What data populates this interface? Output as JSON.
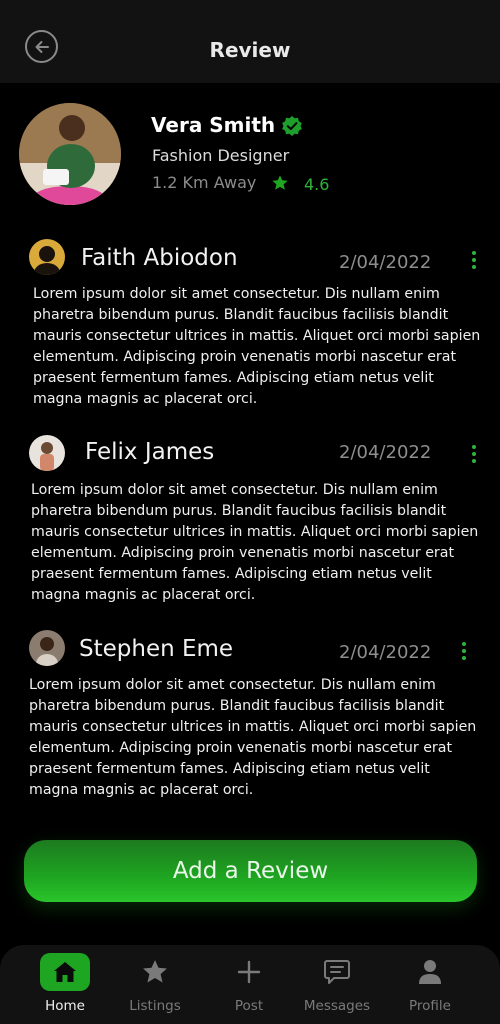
{
  "header": {
    "title": "Review"
  },
  "profile": {
    "name": "Vera Smith",
    "role": "Fashion Designer",
    "distance": "1.2 Km Away",
    "rating": "4.6"
  },
  "reviews": [
    {
      "name": "Faith Abiodon",
      "date": "2/04/2022",
      "text": "Lorem ipsum dolor sit amet consectetur. Dis nullam enim pharetra bibendum purus. Blandit faucibus facilisis blandit mauris consectetur ultrices in mattis. Aliquet orci morbi sapien elementum. Adipiscing proin venenatis morbi nascetur erat praesent fermentum fames. Adipiscing etiam netus velit magna magnis ac placerat orci."
    },
    {
      "name": "Felix James",
      "date": "2/04/2022",
      "text": "Lorem ipsum dolor sit amet consectetur. Dis nullam enim pharetra bibendum purus. Blandit faucibus facilisis blandit mauris consectetur ultrices in mattis. Aliquet orci morbi sapien elementum. Adipiscing proin venenatis morbi nascetur erat praesent fermentum fames. Adipiscing etiam netus velit magna magnis ac placerat orci."
    },
    {
      "name": "Stephen Eme",
      "date": "2/04/2022",
      "text": "Lorem ipsum dolor sit amet consectetur. Dis nullam enim pharetra bibendum purus. Blandit faucibus facilisis blandit mauris consectetur ultrices in mattis. Aliquet orci morbi sapien elementum. Adipiscing proin venenatis morbi nascetur erat praesent fermentum fames. Adipiscing etiam netus velit magna magnis ac placerat orci."
    }
  ],
  "add_review_label": "Add a Review",
  "nav": {
    "items": [
      {
        "label": "Home",
        "icon": "home-icon",
        "active": true
      },
      {
        "label": "Listings",
        "icon": "star-icon",
        "active": false
      },
      {
        "label": "Post",
        "icon": "plus-icon",
        "active": false
      },
      {
        "label": "Messages",
        "icon": "message-icon",
        "active": false
      },
      {
        "label": "Profile",
        "icon": "user-icon",
        "active": false
      }
    ]
  },
  "colors": {
    "accent": "#1ea521",
    "background": "#000000",
    "surface": "#121212"
  }
}
